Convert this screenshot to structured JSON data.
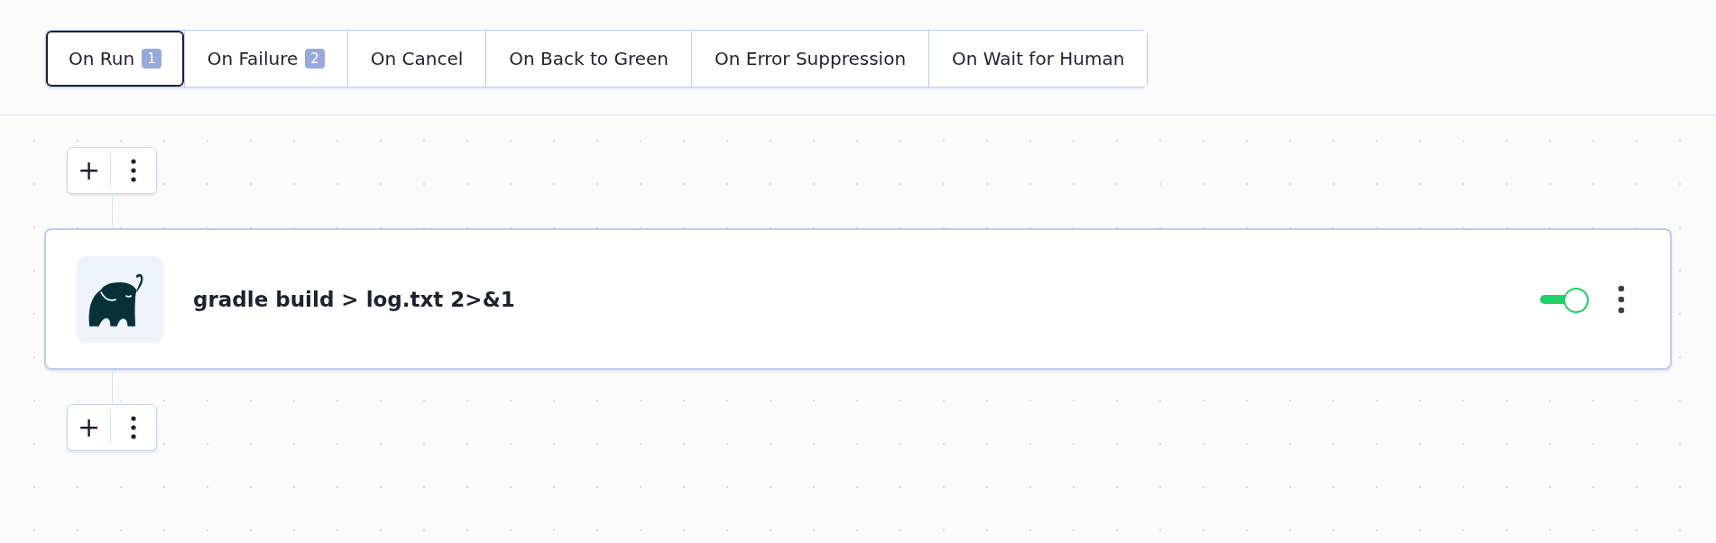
{
  "tabs": [
    {
      "label": "On Run",
      "badge": "1",
      "selected": true
    },
    {
      "label": "On Failure",
      "badge": "2",
      "selected": false
    },
    {
      "label": "On Cancel",
      "selected": false
    },
    {
      "label": "On Back to Green",
      "selected": false
    },
    {
      "label": "On Error Suppression",
      "selected": false
    },
    {
      "label": "On Wait for Human",
      "selected": false
    }
  ],
  "add_controls": [
    {
      "plus": "+"
    },
    {
      "plus": "+"
    }
  ],
  "step": {
    "command": "gradle build > log.txt 2>&1",
    "on": true
  }
}
